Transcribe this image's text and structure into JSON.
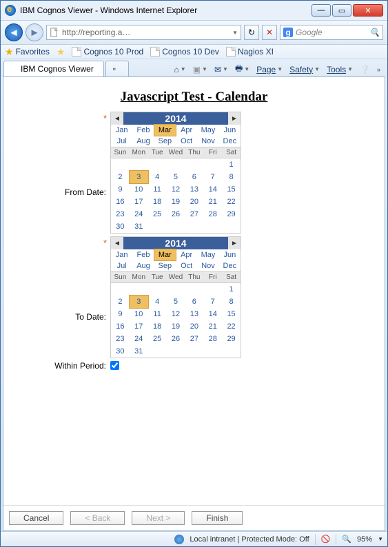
{
  "window": {
    "title": "IBM Cognos Viewer - Windows Internet Explorer"
  },
  "nav": {
    "url": "http://reporting.a…"
  },
  "search": {
    "provider_logo": "g",
    "placeholder": "Google"
  },
  "favorites": {
    "label": "Favorites",
    "links": [
      "Cognos 10 Prod",
      "Cognos 10 Dev",
      "Nagios XI"
    ]
  },
  "tab": {
    "title": "IBM Cognos Viewer"
  },
  "commandbar": {
    "page": "Page",
    "safety": "Safety",
    "tools": "Tools"
  },
  "page": {
    "title": "Javascript Test - Calendar",
    "from_label": "From Date:",
    "to_label": "To Date:",
    "within_label": "Within Period:",
    "within_checked": true
  },
  "calendar": {
    "year": "2014",
    "months_row1": [
      "Jan",
      "Feb",
      "Mar",
      "Apr",
      "May",
      "Jun"
    ],
    "months_row2": [
      "Jul",
      "Aug",
      "Sep",
      "Oct",
      "Nov",
      "Dec"
    ],
    "selected_month_index": 2,
    "dow": [
      "Sun",
      "Mon",
      "Tue",
      "Wed",
      "Thu",
      "Fri",
      "Sat"
    ],
    "first_day_col": 6,
    "num_days": 31,
    "selected_day": 3
  },
  "wizard": {
    "cancel": "Cancel",
    "back": "< Back",
    "next": "Next >",
    "finish": "Finish"
  },
  "status": {
    "zone": "Local intranet | Protected Mode: Off",
    "zoom": "95%"
  }
}
